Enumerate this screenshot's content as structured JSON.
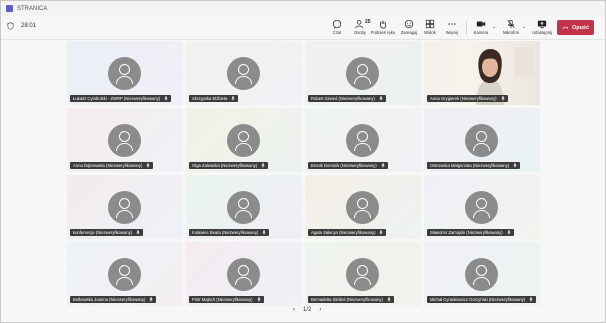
{
  "window": {
    "title": "STRANICA",
    "timer": "28:01"
  },
  "toolbar": {
    "chat_label": "Czat",
    "people_label": "Osoby",
    "people_count": "25",
    "raise_hand_label": "Podnieś rękę",
    "react_label": "Zareaguj",
    "view_label": "Widok",
    "more_label": "Więcej",
    "camera_label": "Kamera",
    "mic_label": "Mikrofon",
    "share_label": "Udostępnij",
    "leave_label": "Opuść"
  },
  "participants": [
    {
      "name": "Łukasz Cymbulski - ZWRP (Niezweryfikowany)"
    },
    {
      "name": "Skrzypska Elżbieta"
    },
    {
      "name": "Robert Szwed (Niezweryfikowany)"
    },
    {
      "name": "Anna Grygierek (Niezweryfikowany)",
      "video": true
    },
    {
      "name": "Anna Dąbrowska (Niezweryfikowany)"
    },
    {
      "name": "Olga Zalewska (Niezweryfikowany)"
    },
    {
      "name": "Bronik Dominik (Niezweryfikowany)"
    },
    {
      "name": "Ostrowska Małgorzata (Niezweryfikowany)"
    },
    {
      "name": "konferencje (Niezweryfikowany)"
    },
    {
      "name": "Kulawiec Beata (Niezweryfikowany)"
    },
    {
      "name": "Agata Sałacyn (Niezweryfikowany)"
    },
    {
      "name": "Sławomir Zamojski (Niezweryfikowany)"
    },
    {
      "name": "Bolkowska Joanna (Niezweryfikowany)"
    },
    {
      "name": "Piotr Majsch (Niezweryfikowany)"
    },
    {
      "name": "Bernadetta Skóbel (Niezweryfikowany)"
    },
    {
      "name": "Michał Cyrankiewicz Gorzyński (Niezweryfikowany)"
    }
  ],
  "pager": {
    "label": "1/2",
    "prev": "‹",
    "next": "›"
  },
  "colors": {
    "leave": "#c4314b",
    "avatar": "#8b8b8b",
    "brand": "#5b5fc7"
  }
}
